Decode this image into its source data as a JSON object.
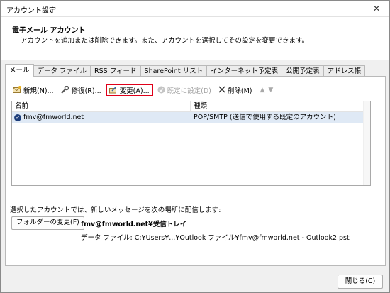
{
  "window": {
    "title": "アカウント設定"
  },
  "header": {
    "title": "電子メール アカウント",
    "description": "アカウントを追加または削除できます。また、アカウントを選択してその設定を変更できます。"
  },
  "tabs": [
    "メール",
    "データ ファイル",
    "RSS フィード",
    "SharePoint リスト",
    "インターネット予定表",
    "公開予定表",
    "アドレス帳"
  ],
  "toolbar": {
    "new_label": "新規(N)...",
    "repair_label": "修復(R)...",
    "change_label": "変更(A)...",
    "default_label": "既定に設定(D)",
    "delete_label": "削除(M)"
  },
  "accounts": {
    "columns": [
      "名前",
      "種類"
    ],
    "rows": [
      {
        "name": "fmv@fmworld.net",
        "type": "POP/SMTP (送信で使用する既定のアカウント)"
      }
    ]
  },
  "delivery": {
    "label": "選択したアカウントでは、新しいメッセージを次の場所に配信します:",
    "change_folder_label": "フォルダーの変更(F)",
    "inbox_path": "fmv@fmworld.net¥受信トレイ",
    "data_file": "データ ファイル: C:¥Users¥...¥Outlook ファイル¥fmv@fmworld.net - Outlook2.pst"
  },
  "footer": {
    "close_label": "閉じる(C)"
  },
  "colors": {
    "highlight": "#e0001a",
    "selected_row": "#dfe9f5"
  }
}
